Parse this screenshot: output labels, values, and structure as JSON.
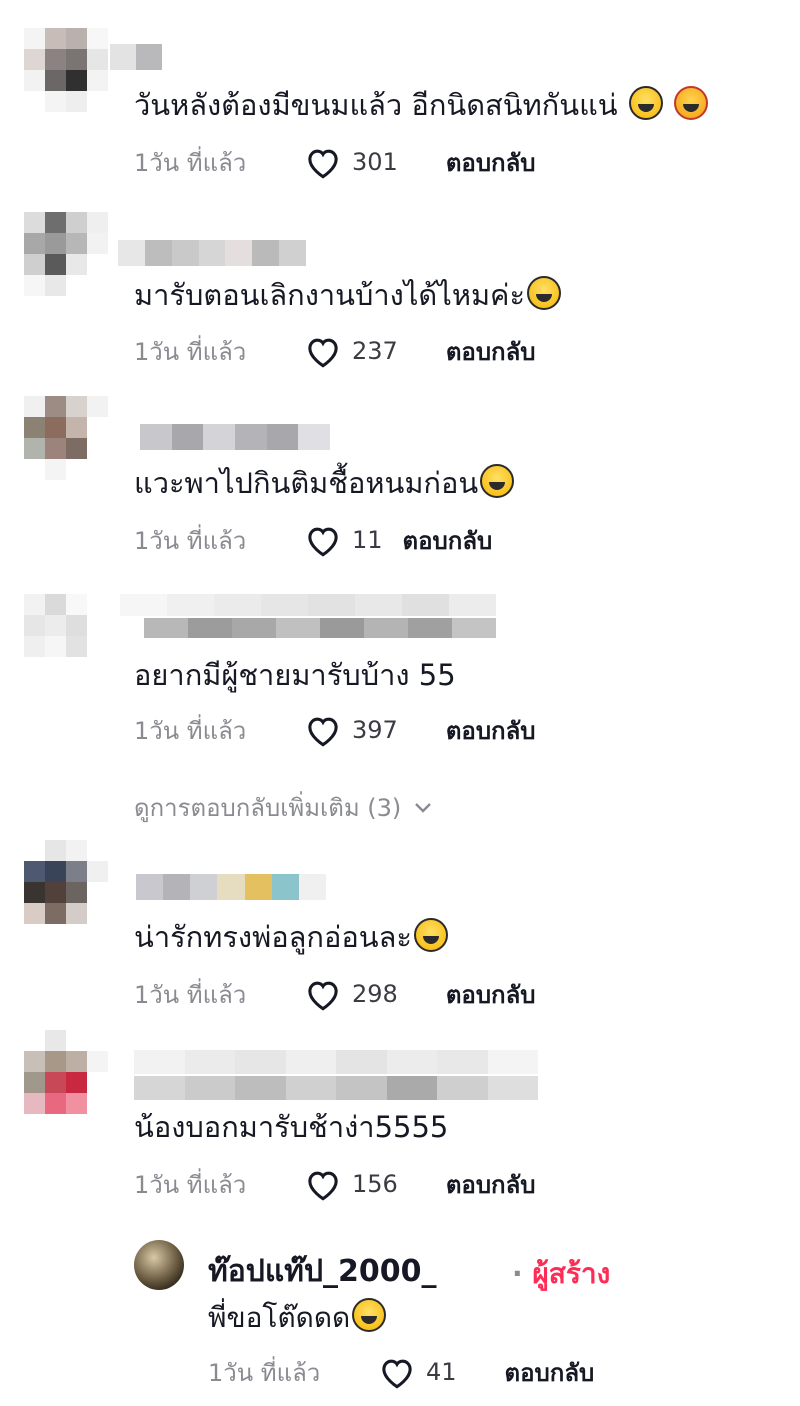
{
  "comments": [
    {
      "text": "วันหลังต้องมีขนมแล้ว อีกนิดสนิทกันแน่",
      "time": "1วัน ที่แล้ว",
      "likes": "301",
      "reply": "ตอบกลับ"
    },
    {
      "text": "มารับตอนเลิกงานบ้างได้ไหมค่ะ",
      "time": "1วัน ที่แล้ว",
      "likes": "237",
      "reply": "ตอบกลับ"
    },
    {
      "text": "แวะพาไปกินติมชื้อหนมก่อน",
      "time": "1วัน ที่แล้ว",
      "likes": "11",
      "reply": "ตอบกลับ"
    },
    {
      "text": "อยากมีผู้ชายมารับบ้าง 55",
      "time": "1วัน ที่แล้ว",
      "likes": "397",
      "reply": "ตอบกลับ"
    },
    {
      "text": "น่ารักทรงพ่อลูกอ่อนละ",
      "time": "1วัน ที่แล้ว",
      "likes": "298",
      "reply": "ตอบกลับ"
    },
    {
      "text": "น้องบอกมารับช้าง่า5555",
      "time": "1วัน ที่แล้ว",
      "likes": "156",
      "reply": "ตอบกลับ"
    }
  ],
  "more_replies": "ดูการตอบกลับเพิ่มเติม (3)",
  "creator_reply": {
    "name": "ท๊อปแท๊ป_2000_",
    "separator": "·",
    "badge": "ผู้สร้าง",
    "text": "พี่ขอโต๊ดดด",
    "time": "1วัน ที่แล้ว",
    "likes": "41",
    "reply": "ตอบกลับ"
  },
  "colors": {
    "accent": "#fe2c55",
    "muted": "#8a8b91",
    "text": "#161823"
  },
  "icons": {
    "like": "heart-outline-icon",
    "expand": "chevron-down-icon",
    "emoji": "grinning-face-icon"
  }
}
